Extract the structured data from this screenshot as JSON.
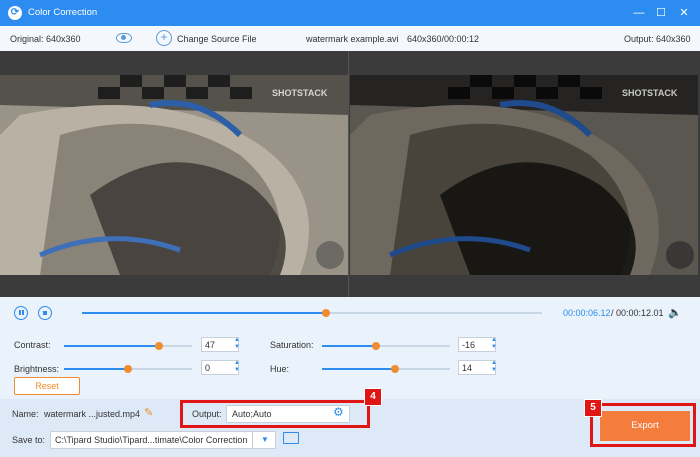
{
  "window": {
    "title": "Color Correction",
    "logo_glyph": "⟳",
    "minimize": "—",
    "maximize": "☐",
    "close": "✕"
  },
  "infobar": {
    "original": "Original: 640x360",
    "change_source": "Change Source File",
    "file_info": "watermark example.avi",
    "file_time": "640x360/00:00:12",
    "output": "Output: 640x360"
  },
  "preview": {
    "watermark": "SHOTSTACK"
  },
  "playback": {
    "current_time": "00:00:06.12",
    "total_time": "00:00:12.01",
    "progress": 0.53
  },
  "adjust": {
    "contrast": {
      "label": "Contrast:",
      "value": "47",
      "level": 0.74
    },
    "saturation": {
      "label": "Saturation:",
      "value": "-16",
      "level": 0.42
    },
    "brightness": {
      "label": "Brightness:",
      "value": "0",
      "level": 0.5
    },
    "hue": {
      "label": "Hue:",
      "value": "14",
      "level": 0.57
    },
    "reset_label": "Reset"
  },
  "output_settings": {
    "name_label": "Name:",
    "name_value": "watermark ...justed.mp4",
    "output_label": "Output:",
    "output_value": "Auto;Auto",
    "save_label": "Save to:",
    "save_path": "C:\\Tipard Studio\\Tipard...timate\\Color Correction",
    "export_label": "Export"
  },
  "annotations": {
    "badge_output": "4",
    "badge_export": "5"
  },
  "colors": {
    "accent": "#2d8cf0",
    "orange": "#f08c2d",
    "highlight": "#e01616"
  }
}
